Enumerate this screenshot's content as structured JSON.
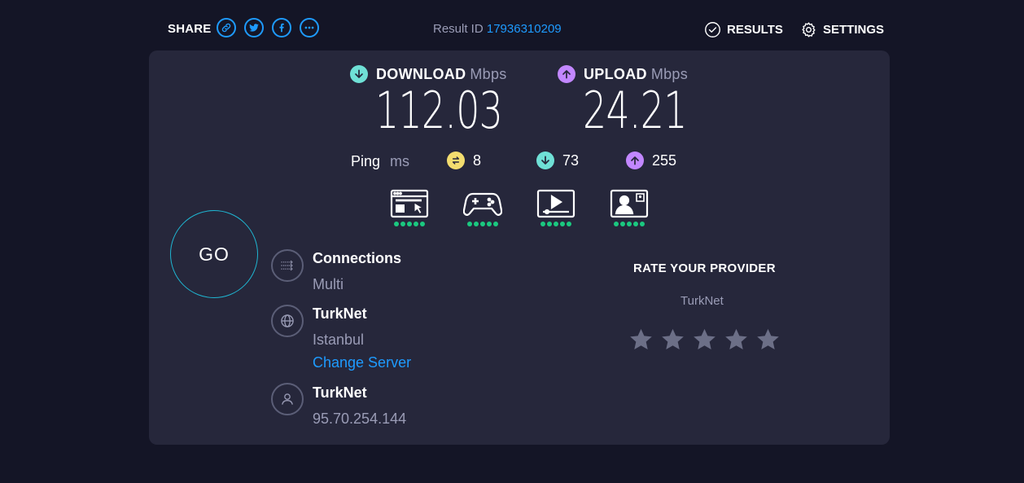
{
  "header": {
    "share_label": "SHARE",
    "share_buttons": [
      "link-icon",
      "twitter-icon",
      "facebook-icon",
      "more-icon"
    ],
    "result_label": "Result ID",
    "result_id": "17936310209",
    "results_label": "RESULTS",
    "settings_label": "SETTINGS"
  },
  "download": {
    "label": "DOWNLOAD",
    "unit": "Mbps",
    "value": "112.03",
    "color": "#6fe0d6"
  },
  "upload": {
    "label": "UPLOAD",
    "unit": "Mbps",
    "value": "24.21",
    "color": "#c287ff"
  },
  "ping": {
    "label": "Ping",
    "unit": "ms",
    "idle": {
      "value": "8",
      "icon": "ping-idle-icon",
      "color": "#f3dd6f"
    },
    "download": {
      "value": "73",
      "icon": "ping-download-icon",
      "color": "#6fe0d6"
    },
    "upload": {
      "value": "255",
      "icon": "ping-upload-icon",
      "color": "#c287ff"
    }
  },
  "activities": [
    {
      "name": "web-browsing-icon",
      "rating": 5
    },
    {
      "name": "gaming-icon",
      "rating": 5
    },
    {
      "name": "video-streaming-icon",
      "rating": 5
    },
    {
      "name": "video-chat-icon",
      "rating": 5
    }
  ],
  "go_label": "GO",
  "connections": {
    "title": "Connections",
    "value": "Multi"
  },
  "server": {
    "name": "TurkNet",
    "location": "Istanbul",
    "change_label": "Change Server"
  },
  "provider": {
    "name": "TurkNet",
    "ip": "95.70.254.144"
  },
  "rating": {
    "title": "RATE YOUR PROVIDER",
    "provider": "TurkNet",
    "stars": 5,
    "star_color": "#6c6f87"
  },
  "colors": {
    "background": "#141526",
    "card": "#26273b",
    "accent": "#1e9bff",
    "go_ring": "#1fb6d2",
    "good": "#1bc980"
  }
}
